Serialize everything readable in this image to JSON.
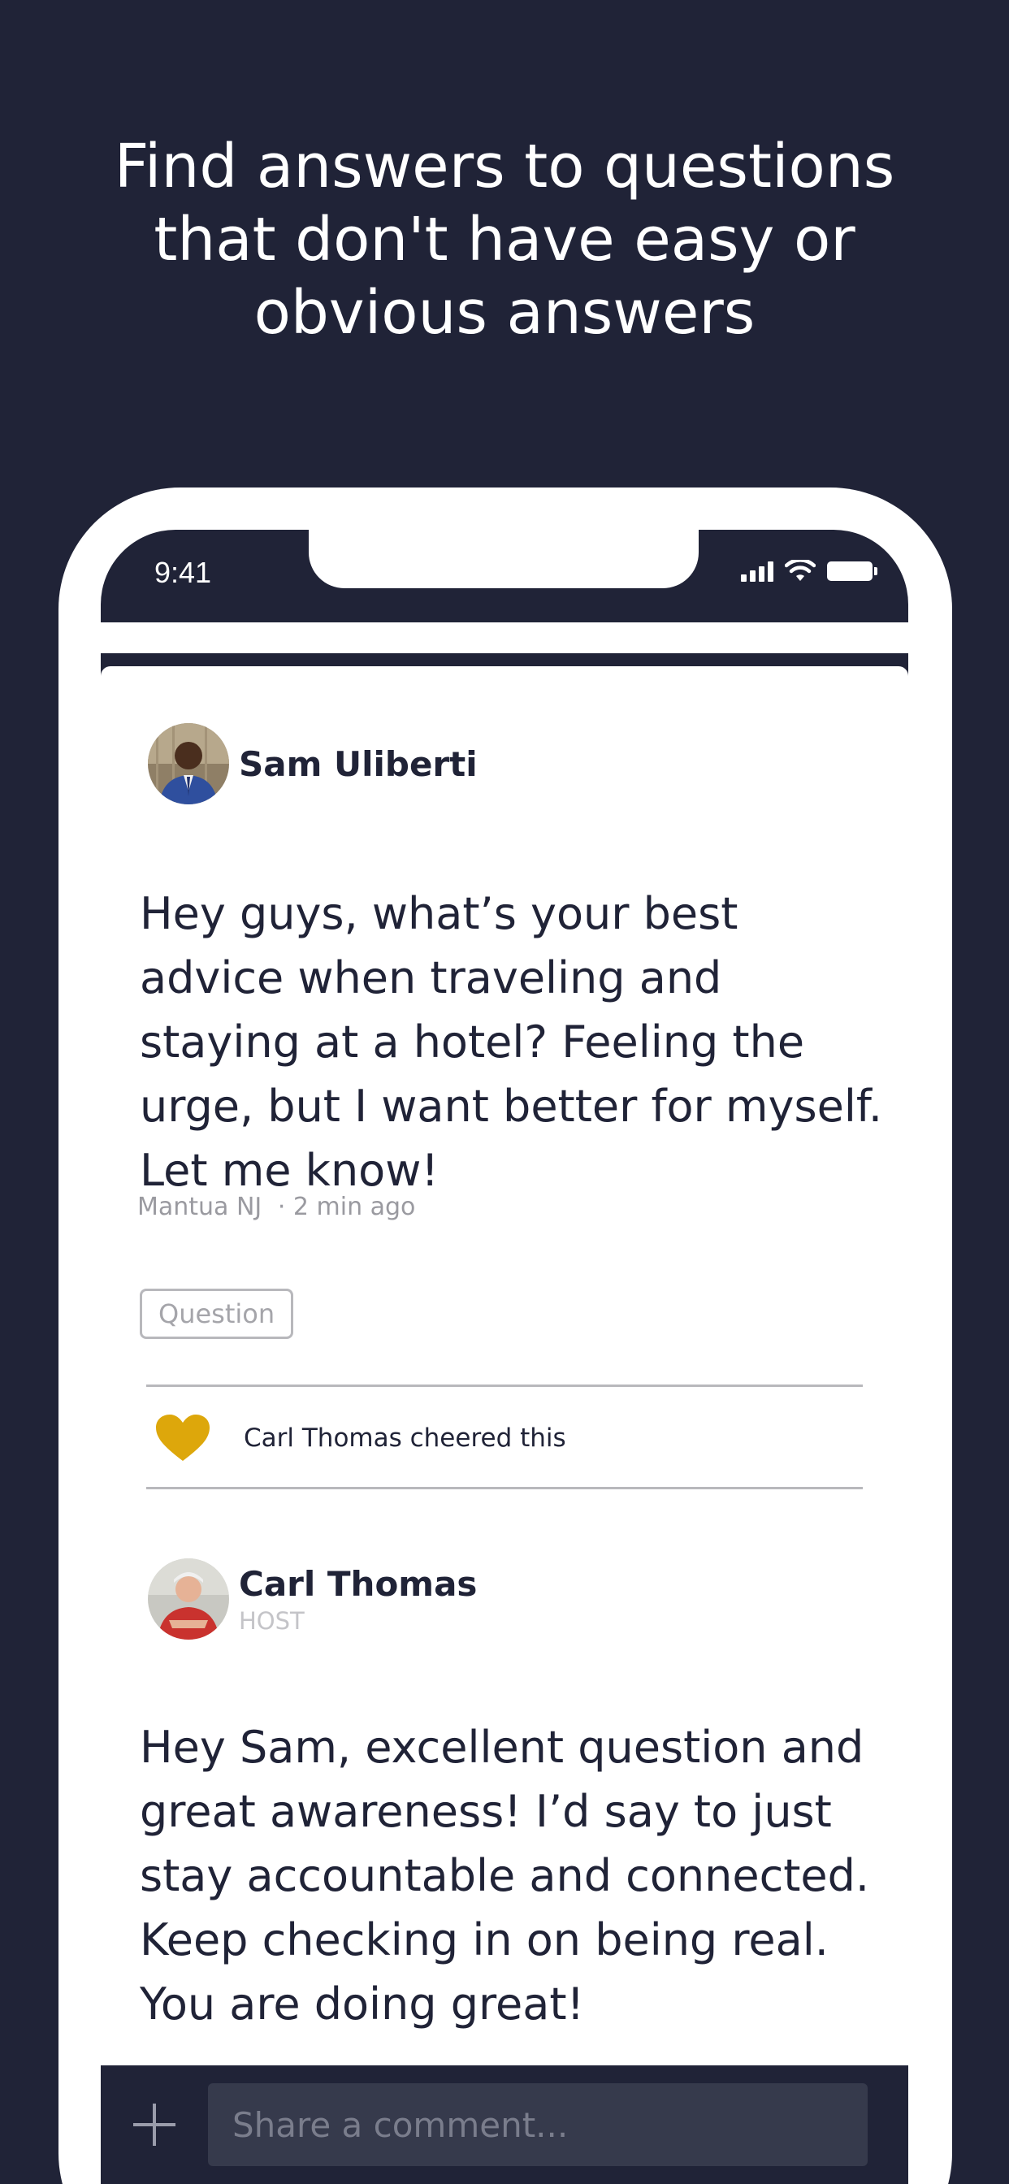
{
  "headline": "Find answers to questions that don't have easy or obvious answers",
  "status_bar": {
    "time": "9:41"
  },
  "post": {
    "author": "Sam Uliberti",
    "body": "Hey guys, what’s your best advice when traveling and staying at a hotel? Feeling the urge, but I want better for myself. Let me know!",
    "location": "Mantua NJ",
    "time_ago": "· 2 min ago",
    "tag": "Question",
    "cheer_text": "Carl Thomas cheered this"
  },
  "reply": {
    "author": "Carl Thomas",
    "role": "HOST",
    "body": "Hey Sam, excellent question and great awareness! I’d say to just stay accountable and connected. Keep checking in on being real. You are doing great!"
  },
  "comment_bar": {
    "placeholder": "Share a comment..."
  },
  "colors": {
    "background": "#202337",
    "heart": "#dda70b",
    "text": "#202337"
  },
  "icons": [
    "signal-icon",
    "wifi-icon",
    "battery-icon",
    "heart-icon",
    "plus-icon"
  ]
}
